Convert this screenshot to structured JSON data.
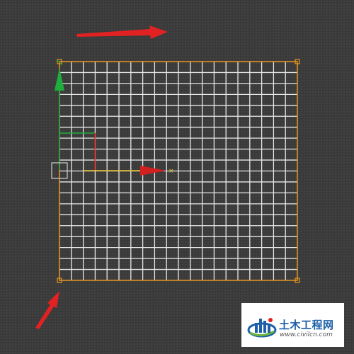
{
  "viewport": {
    "name": "3d-viewport",
    "grid_rows": 20,
    "grid_cols": 20,
    "colors": {
      "background": "#3a3a3a",
      "grid_lines": "#e8e8e8",
      "selection_border": "#e8961e",
      "axis_x": "#e8c020",
      "axis_y": "#1fae3c",
      "axis_z": "#d02020",
      "annotation_arrow": "#e22222"
    }
  },
  "watermark": {
    "title": "土木工程网",
    "url": "www.civilcn.com",
    "logo_icon": "building-bars-icon",
    "colors": {
      "blue": "#1d5fa8",
      "green": "#6bb43b",
      "red": "#e02020"
    }
  }
}
